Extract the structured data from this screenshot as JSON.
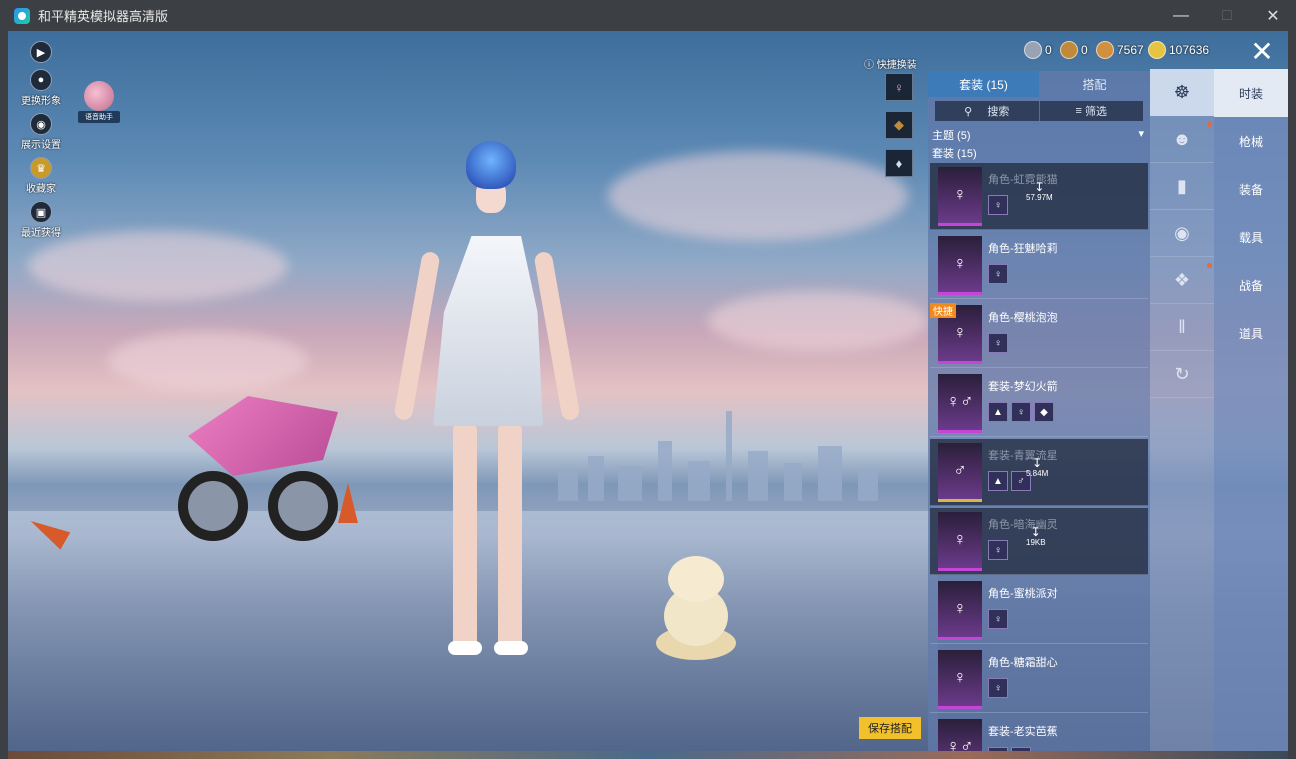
{
  "window": {
    "title": "和平精英模拟器高清版"
  },
  "left_tools": [
    {
      "label": "更换形象",
      "icon": "play-icon"
    },
    {
      "label": "展示设置",
      "icon": "eye-icon"
    },
    {
      "label": "收藏家",
      "icon": "collector-icon"
    },
    {
      "label": "最近获得",
      "icon": "gift-icon"
    }
  ],
  "assistant": {
    "label": "语音助手"
  },
  "currency": [
    {
      "icon": "coin-silver-icon",
      "value": "0",
      "color": "#9aa3b3"
    },
    {
      "icon": "coin-bronze-icon",
      "value": "0",
      "color": "#c08a3a"
    },
    {
      "icon": "coin-copper-icon",
      "value": "7567",
      "color": "#d09040"
    },
    {
      "icon": "coin-gold-icon",
      "value": "107636",
      "color": "#e6c340"
    }
  ],
  "quick_change": {
    "label": "快捷换装"
  },
  "panel": {
    "tabs": [
      {
        "label": "套装 (15)",
        "active": true
      },
      {
        "label": "搭配",
        "active": false
      }
    ],
    "search_label": "搜索",
    "filter_label": "筛选",
    "theme_label": "主题 (5)",
    "section_label": "套装 (15)",
    "items": [
      {
        "name": "角色-虹霓熊猫",
        "dim": true,
        "download": "57.97M",
        "subs": 1
      },
      {
        "name": "角色-狂魅哈莉",
        "dim": false,
        "subs": 1
      },
      {
        "name": "角色-樱桃泡泡",
        "dim": false,
        "subs": 1,
        "badge": "快捷"
      },
      {
        "name": "套装-梦幻火箭",
        "dim": false,
        "subs": 3
      },
      {
        "name": "套装-青翼流星",
        "dim": true,
        "download": "5.84M",
        "subs": 2
      },
      {
        "name": "角色-暗海幽灵",
        "dim": true,
        "download": "19KB",
        "subs": 1
      },
      {
        "name": "角色-蜜桃派对",
        "dim": false,
        "subs": 1
      },
      {
        "name": "角色-糖霜甜心",
        "dim": false,
        "subs": 1
      },
      {
        "name": "套装-老实芭蕉",
        "dim": false,
        "subs": 2
      }
    ],
    "save_label": "保存搭配"
  },
  "categories": [
    {
      "label": "时装",
      "active": true
    },
    {
      "label": "枪械",
      "active": false
    },
    {
      "label": "装备",
      "active": false
    },
    {
      "label": "载具",
      "active": false
    },
    {
      "label": "战备",
      "active": false
    },
    {
      "label": "道具",
      "active": false
    }
  ],
  "icon_column": [
    {
      "icon": "outfit-icon",
      "active": true
    },
    {
      "icon": "emote-icon",
      "active": false
    },
    {
      "icon": "backpack-skin-icon",
      "active": false
    },
    {
      "icon": "mask-icon",
      "active": false
    },
    {
      "icon": "top-icon",
      "active": false
    },
    {
      "icon": "pants-icon",
      "active": false
    },
    {
      "icon": "shoes-icon",
      "active": false
    }
  ],
  "colors": {
    "accent": "#3d7ab8",
    "save": "#f2c02a",
    "quick_badge": "#f08a1e"
  }
}
